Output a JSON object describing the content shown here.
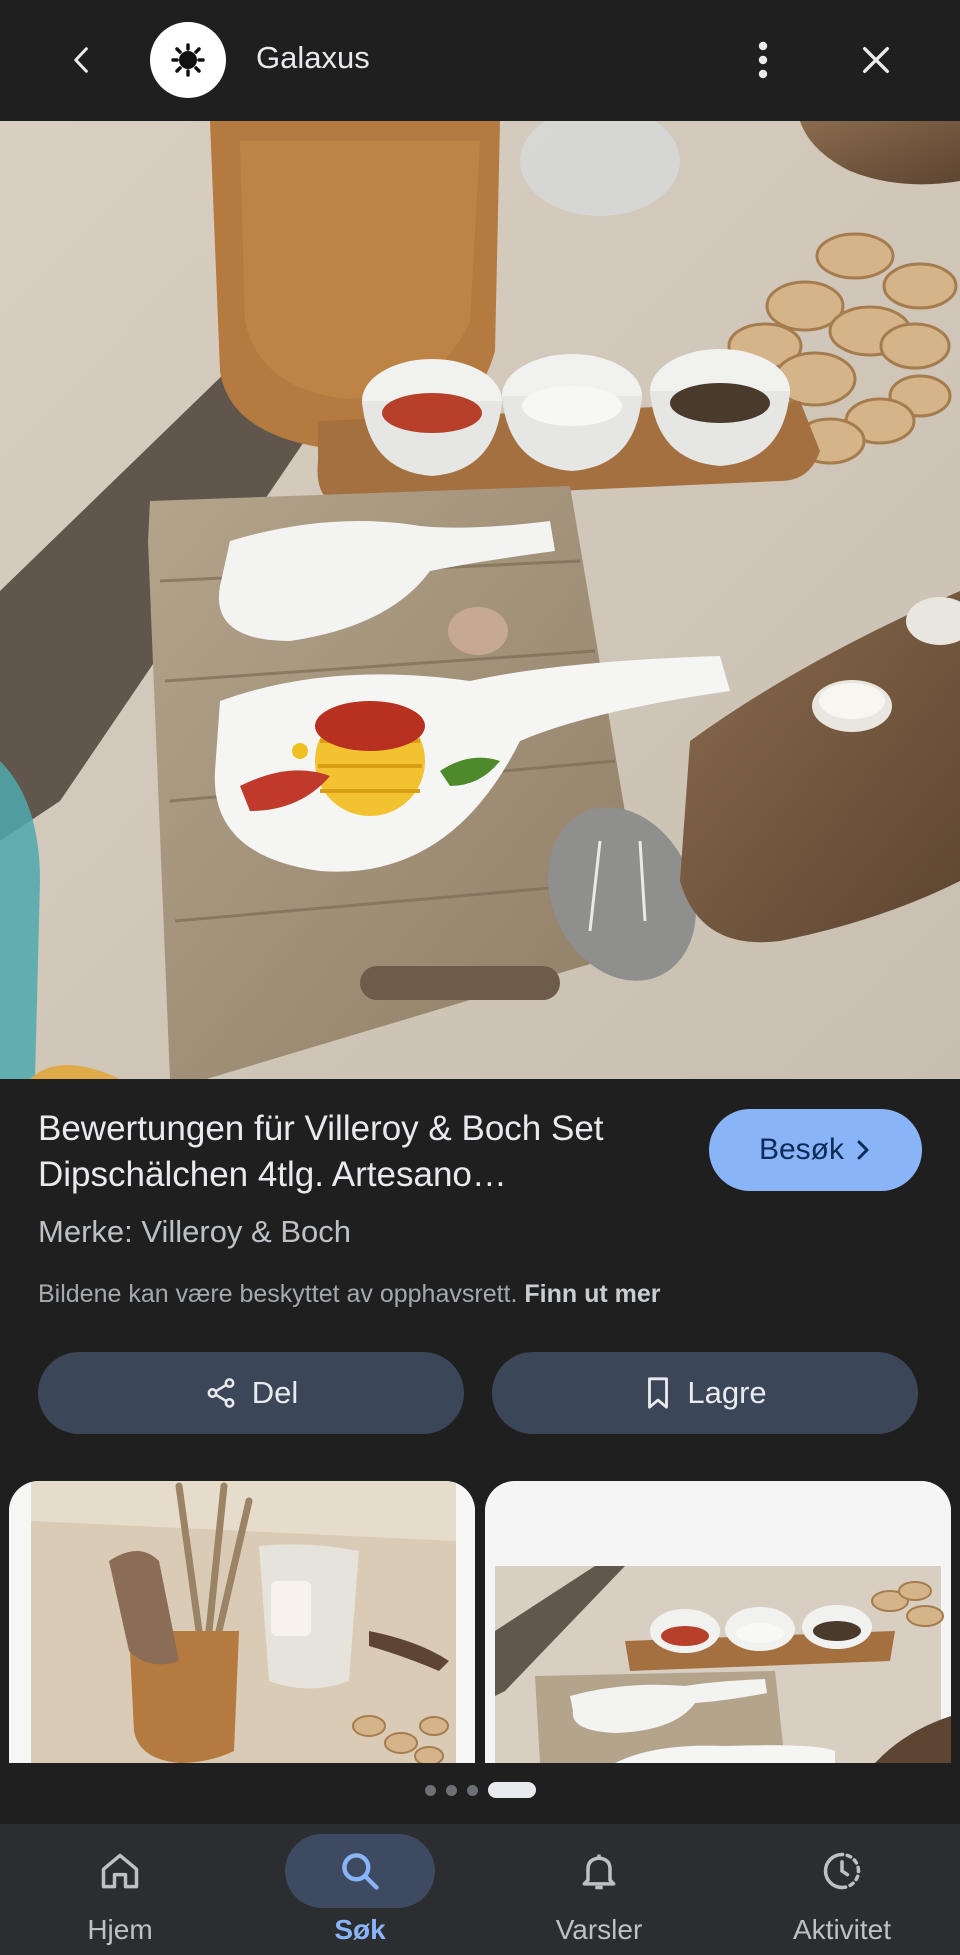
{
  "header": {
    "site_name": "Galaxus",
    "back_icon": "back-arrow-icon",
    "logo_icon": "galaxus-logo-icon",
    "more_icon": "more-vert-icon",
    "close_icon": "close-icon"
  },
  "product": {
    "title": "Bewertungen für Villeroy & Boch Set Dipschälchen 4tlg. Artesano…",
    "visit_label": "Besøk",
    "brand": "Merke: Villeroy & Boch",
    "copyright_text": "Bildene kan være beskyttet av opphavsrett.",
    "copyright_link": "Finn ut mer"
  },
  "actions": {
    "share_label": "Del",
    "save_label": "Lagre"
  },
  "pager": {
    "count": 4,
    "active_index": 3
  },
  "bottom_nav": {
    "items": [
      {
        "label": "Hjem",
        "icon": "home-icon"
      },
      {
        "label": "Søk",
        "icon": "search-icon"
      },
      {
        "label": "Varsler",
        "icon": "bell-icon"
      },
      {
        "label": "Aktivitet",
        "icon": "activity-icon"
      }
    ],
    "active": "Søk"
  },
  "colors": {
    "background": "#1f1f1f",
    "accent": "#8ab4f8",
    "button_bg": "#3b4658",
    "nav_bg": "#2b2d30"
  }
}
